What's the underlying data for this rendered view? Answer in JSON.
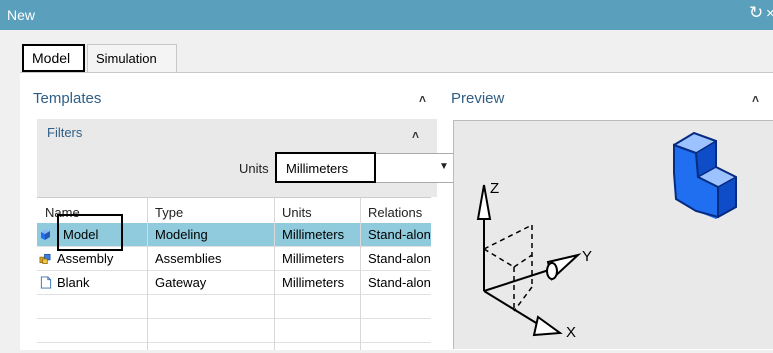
{
  "window": {
    "title": "New",
    "refresh_icon": "refresh-icon",
    "close_icon": "close-icon"
  },
  "tabs": [
    {
      "label": "Model",
      "selected": true
    },
    {
      "label": "Simulation",
      "selected": false
    }
  ],
  "templates": {
    "title": "Templates",
    "collapse_icon": "chevron-up-icon"
  },
  "filters": {
    "title": "Filters",
    "collapse_icon": "chevron-up-icon",
    "units_label": "Units",
    "units_value": "Millimeters",
    "dropdown_icon": "caret-down-icon"
  },
  "table": {
    "columns": [
      "Name",
      "Type",
      "Units",
      "Relations"
    ],
    "rows": [
      {
        "name": "Model",
        "type": "Modeling",
        "units": "Millimeters",
        "relations": "Stand-alone",
        "icon": "model-part-icon",
        "selected": true
      },
      {
        "name": "Assembly",
        "type": "Assemblies",
        "units": "Millimeters",
        "relations": "Stand-alone",
        "icon": "assembly-icon",
        "selected": false
      },
      {
        "name": "Blank",
        "type": "Gateway",
        "units": "Millimeters",
        "relations": "Stand-alone",
        "icon": "blank-document-icon",
        "selected": false
      }
    ]
  },
  "preview": {
    "title": "Preview",
    "collapse_icon": "chevron-up-icon",
    "axis_labels": {
      "x": "X",
      "y": "Y",
      "z": "Z"
    }
  },
  "colors": {
    "titlebar": "#5a9fbc",
    "section_title": "#2f5f86",
    "selection": "#8fcbdd",
    "preview_cube": "#1f6ff0"
  }
}
